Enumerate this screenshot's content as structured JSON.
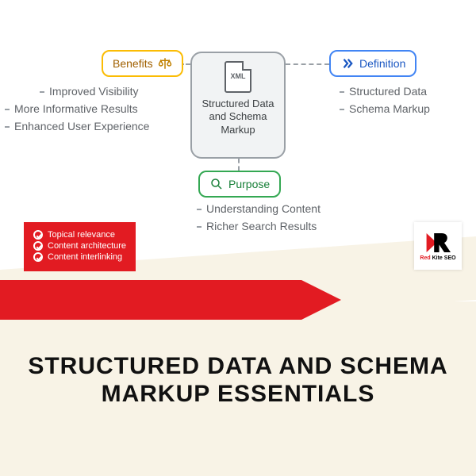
{
  "center": {
    "icon_label": "XML",
    "label": "Structured Data and Schema Markup"
  },
  "branches": {
    "benefits": {
      "label": "Benefits",
      "items": [
        "Improved Visibility",
        "More Informative Results",
        "Enhanced User Experience"
      ]
    },
    "definition": {
      "label": "Definition",
      "items": [
        "Structured Data",
        "Schema Markup"
      ]
    },
    "purpose": {
      "label": "Purpose",
      "items": [
        "Understanding Content",
        "Richer Search Results"
      ]
    }
  },
  "checklist": [
    "Topical relevance",
    "Content architecture",
    "Content interlinking"
  ],
  "logo": {
    "text_red": "Red",
    "text_black": " Kite SEO"
  },
  "title": "STRUCTURED DATA AND SCHEMA MARKUP ESSENTIALS"
}
